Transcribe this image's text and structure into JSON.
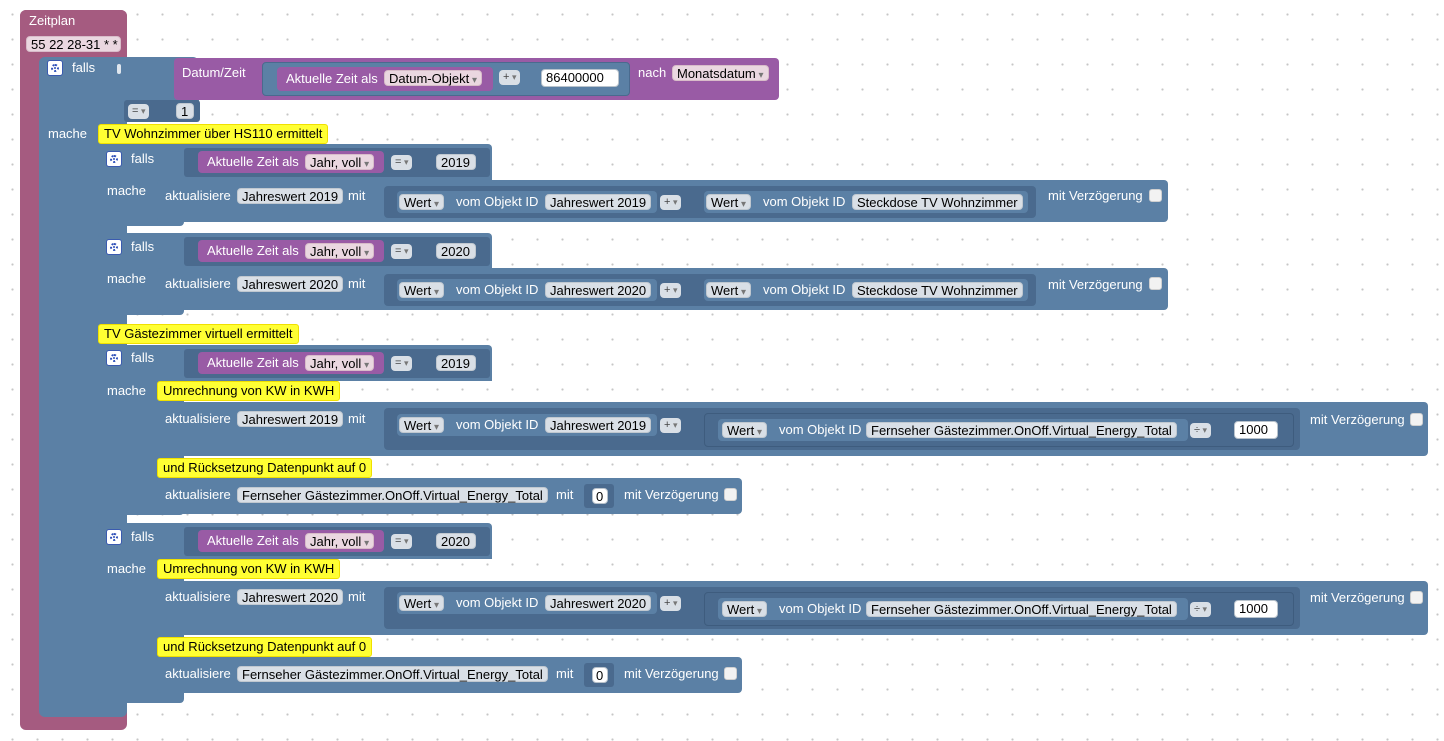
{
  "zeitplan": {
    "title": "Zeitplan",
    "cron": "55 22 28-31 * *",
    "falls_label": "falls",
    "mache_label": "mache",
    "datum_label": "Datum/Zeit",
    "aktuelle_zeit_als": "Aktuelle Zeit als",
    "datum_objekt": "Datum-Objekt",
    "plus": "+",
    "offset_ms": "86400000",
    "nach_label": "nach",
    "monatsdatum": "Monatsdatum",
    "equals": "=",
    "compare_value": "1"
  },
  "labels": {
    "falls": "falls",
    "mache": "mache",
    "aktuelle_zeit_als": "Aktuelle Zeit als",
    "jahr_voll": "Jahr, voll",
    "aktualisiere": "aktualisiere",
    "mit": "mit",
    "wert": "Wert",
    "vom_objekt_id": "vom Objekt ID",
    "mit_verzoegerung": "mit Verzögerung",
    "plus": "+",
    "eq": "=",
    "div": "÷"
  },
  "comments": {
    "wohnzimmer": "TV Wohnzimmer über HS110 ermittelt",
    "gaestezimmer": "TV Gästezimmer virtuell ermittelt",
    "umrechnung1": "Umrechnung von KW in KWH",
    "reset1": "und Rücksetzung Datenpunkt auf 0",
    "umrechnung2": "Umrechnung von KW in KWH",
    "reset2": "und Rücksetzung Datenpunkt auf 0"
  },
  "blocks": {
    "w2019": {
      "year": "2019",
      "target": "Jahreswert 2019",
      "object": "Jahreswert 2019",
      "source": "Steckdose TV Wohnzimmer"
    },
    "w2020": {
      "year": "2020",
      "target": "Jahreswert 2020",
      "object": "Jahreswert 2020",
      "source": "Steckdose TV Wohnzimmer"
    },
    "g2019": {
      "year": "2019",
      "target": "Jahreswert 2019",
      "object": "Jahreswert 2019",
      "source": "Fernseher Gästezimmer.OnOff.Virtual_Energy_Total",
      "divisor": "1000",
      "reset_target": "Fernseher Gästezimmer.OnOff.Virtual_Energy_Total",
      "reset_value": "0"
    },
    "g2020": {
      "year": "2020",
      "target": "Jahreswert 2020",
      "object": "Jahreswert 2020",
      "source": "Fernseher Gästezimmer.OnOff.Virtual_Energy_Total",
      "divisor": "1000",
      "reset_target": "Fernseher Gästezimmer.OnOff.Virtual_Energy_Total",
      "reset_value": "0"
    }
  },
  "colors": {
    "schedule": "#a55b80",
    "logic": "#5b80a5",
    "time": "#995ba5",
    "comment": "#ffff33"
  }
}
